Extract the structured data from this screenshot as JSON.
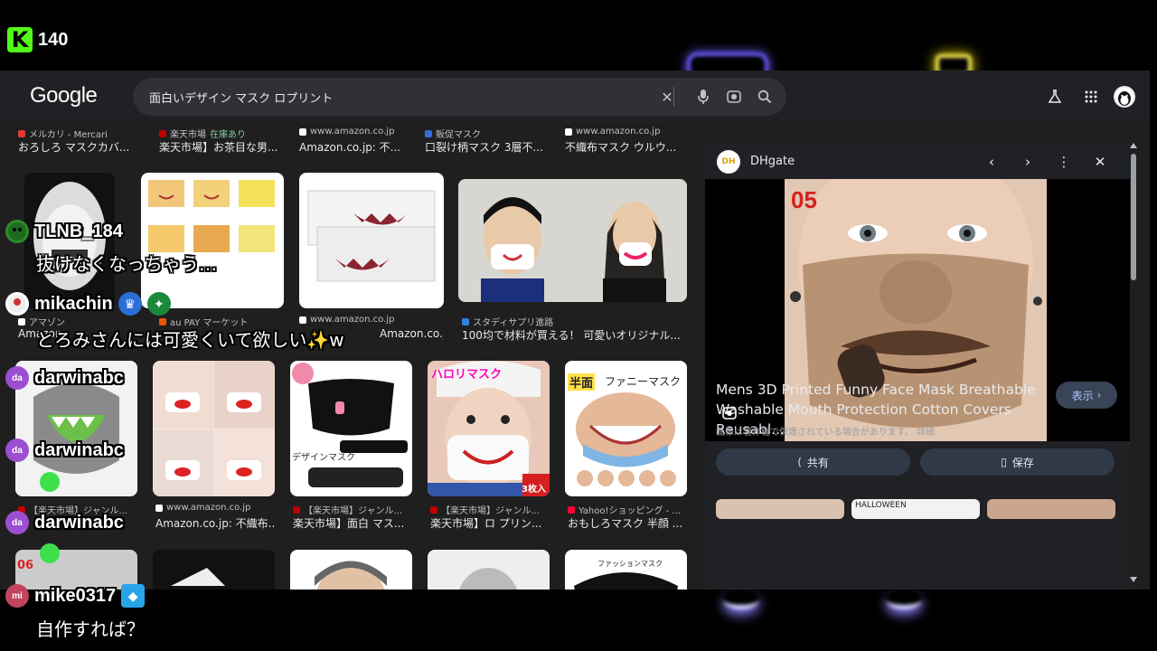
{
  "stream": {
    "viewer_count": "140"
  },
  "search": {
    "logo": "Google",
    "query": "面白いデザイン マスク ロプリント"
  },
  "row1": [
    {
      "source": "メルカリ - Mercari",
      "stock": "",
      "title": "おろしろ マスクカバ..."
    },
    {
      "source": "楽天市場",
      "stock": "在庫あり",
      "title": "楽天市場】お茶目な男..."
    },
    {
      "source": "www.amazon.co.jp",
      "stock": "",
      "title": "Amazon.co.jp: 不..."
    },
    {
      "source": "販促マスク",
      "stock": "",
      "title": "口裂け柄マスク 3層不..."
    },
    {
      "source": "www.amazon.co.jp",
      "stock": "",
      "title": "不織布マスク ウルウ..."
    }
  ],
  "row2": [
    {
      "source": "アマゾン",
      "title": "Amazon"
    },
    {
      "source": "au PAY マーケット",
      "title": ""
    },
    {
      "source": "www.amazon.co.jp",
      "title": "Amazon.co.jp:..."
    },
    {
      "source": "スタディサプリ進路",
      "title": "100均で材料が買える！ 可愛いオリジナル..."
    }
  ],
  "row3": [
    {
      "source": "【楽天市場】ジャンル...",
      "title": ""
    },
    {
      "source": "www.amazon.co.jp",
      "title": "Amazon.co.jp: 不織布..."
    },
    {
      "source": "【楽天市場】ジャンル...",
      "title": "楽天市場】面白 マス..."
    },
    {
      "source": "【楽天市場】ジャンル...",
      "title": "楽天市場】ロ プリン..."
    },
    {
      "source": "Yahoo!ショッピング - ...",
      "title": "おもしろマスク 半顔 ..."
    }
  ],
  "thumb_text": {
    "t1": "ハロリマスク",
    "t2": "半面",
    "t3": "ファニーマスク",
    "t4": "デザインマスク",
    "t5": "3枚入",
    "t6": "05",
    "t7": "06",
    "t8": "ファッションマスク",
    "t9": "HALLOWEEN"
  },
  "panel": {
    "site": "DHgate",
    "site_logo": "DH",
    "title": "Mens 3D Printed Funny Face Mask Breathable Washable Mouth Protection Cotton Covers Reusabl...",
    "show_label": "表示",
    "note": "画像は著作権で保護されている場合があります。 詳細",
    "share_label": "共有",
    "save_label": "保存"
  },
  "chat": [
    {
      "user": "TLNB_184",
      "message": "抜けなくなっちゃう…",
      "avatar": ""
    },
    {
      "user": "mikachin",
      "message": "とろみさんには可愛くいて欲しい✨w",
      "avatar": ""
    },
    {
      "user": "darwinabc",
      "message": "",
      "avatar": "da"
    },
    {
      "user": "darwinabc",
      "message": "",
      "avatar": "da"
    },
    {
      "user": "darwinabc",
      "message": "",
      "avatar": "da"
    },
    {
      "user": "mike0317",
      "message": "自作すれば？",
      "avatar": "mi"
    }
  ],
  "colors": {
    "kick_green": "#53fc18",
    "panel_bg": "#202124",
    "accent_blue": "#a8c7fa"
  }
}
